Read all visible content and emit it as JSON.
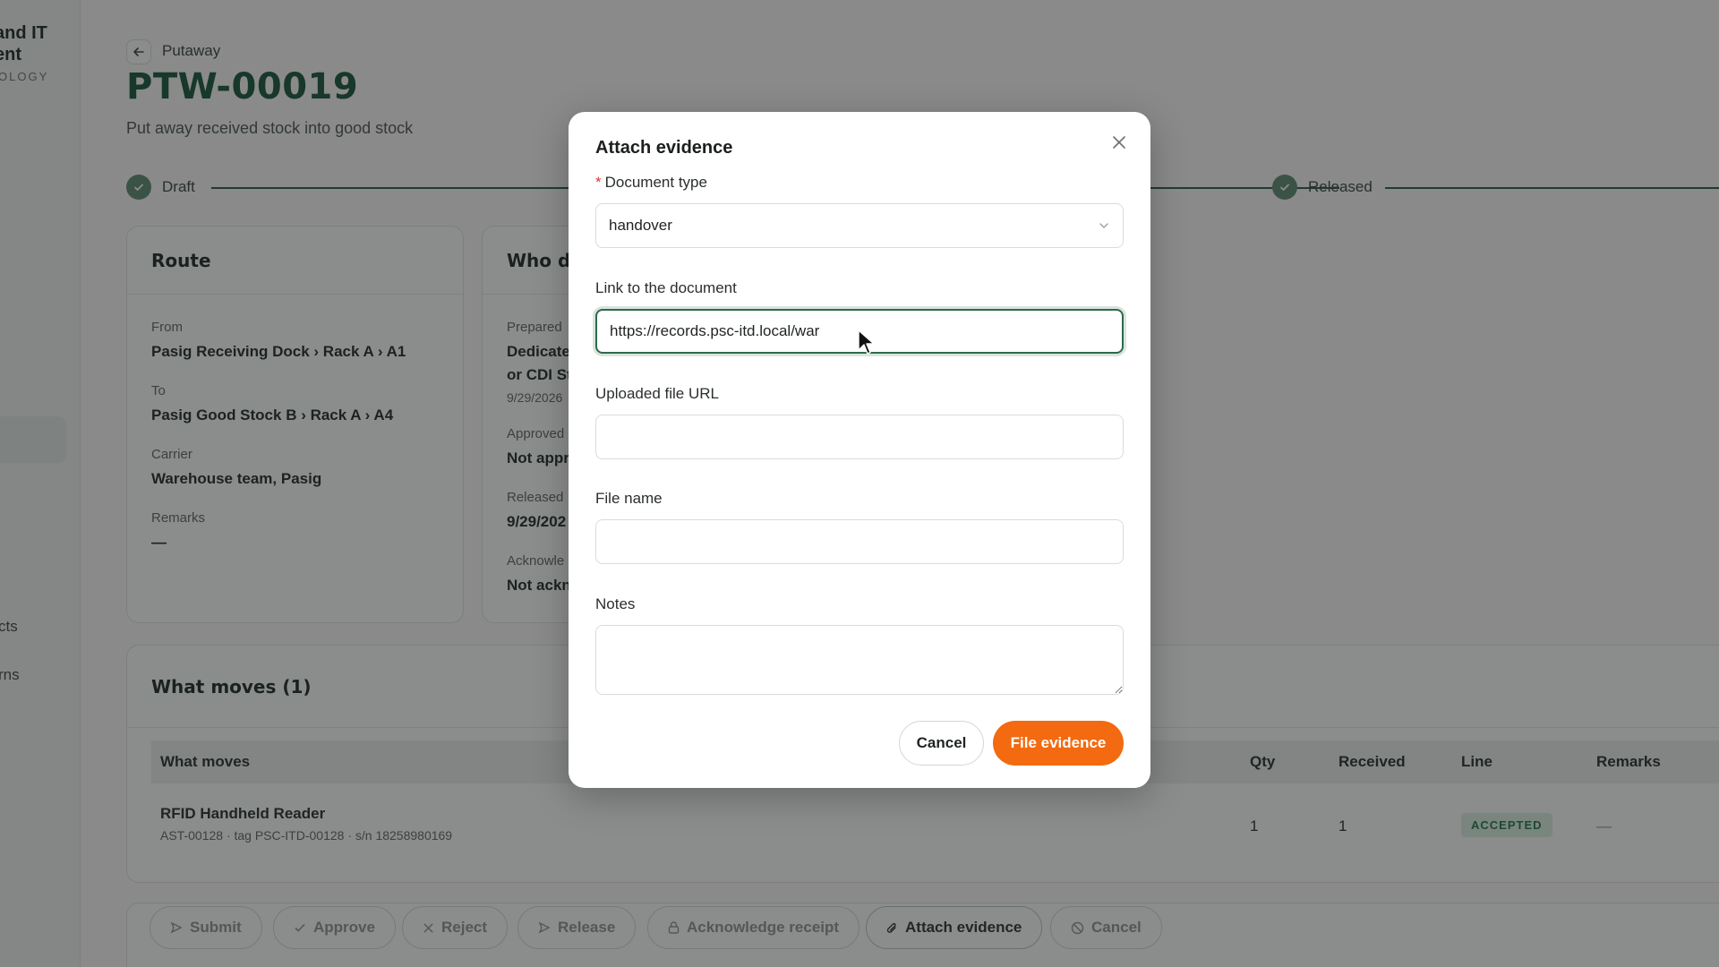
{
  "sidebar": {
    "brand_line1": "and IT",
    "brand_line2": "ent",
    "brand_sub": "OLOGY",
    "items": [
      {
        "label": "cts"
      },
      {
        "label": "rns"
      }
    ]
  },
  "header": {
    "breadcrumb": "Putaway",
    "title": "PTW-00019",
    "subtitle": "Put away received stock into good stock"
  },
  "stepper": {
    "steps": [
      {
        "label": "Draft"
      },
      {
        "label": "Released"
      }
    ]
  },
  "route_card": {
    "title": "Route",
    "from_label": "From",
    "from_value": "Pasig Receiving Dock › Rack A › A1",
    "to_label": "To",
    "to_value": "Pasig Good Stock B › Rack A › A4",
    "carrier_label": "Carrier",
    "carrier_value": "Warehouse team, Pasig",
    "remarks_label": "Remarks",
    "remarks_value": "—"
  },
  "who_card": {
    "title": "Who d",
    "prepared_label": "Prepared",
    "prepared_value_1": "Dedicate",
    "prepared_value_2": "or CDI St",
    "prepared_date": "9/29/2026",
    "approved_label": "Approved",
    "approved_value": "Not appr",
    "released_label": "Released",
    "released_value": "9/29/202",
    "acknowledged_label": "Acknowle",
    "acknowledged_value": "Not ackn"
  },
  "moves": {
    "title": "What moves (1)",
    "columns": [
      "What moves",
      "Qty",
      "Received",
      "Line",
      "Remarks"
    ],
    "rows": [
      {
        "name": "RFID Handheld Reader",
        "meta": "AST-00128 · tag PSC-ITD-00128 · s/n 18258980169",
        "qty": "1",
        "received": "1",
        "line": "ACCEPTED",
        "remarks": "—"
      }
    ]
  },
  "actions": {
    "submit": "Submit",
    "approve": "Approve",
    "reject": "Reject",
    "release": "Release",
    "acknowledge": "Acknowledge receipt",
    "attach": "Attach evidence",
    "cancel": "Cancel"
  },
  "modal": {
    "title": "Attach evidence",
    "document_type_label": "Document type",
    "document_type_value": "handover",
    "link_label": "Link to the document",
    "link_value": "https://records.psc-itd.local/war",
    "uploaded_label": "Uploaded file URL",
    "uploaded_value": "",
    "file_name_label": "File name",
    "file_name_value": "",
    "notes_label": "Notes",
    "notes_value": "",
    "cancel_label": "Cancel",
    "submit_label": "File evidence"
  },
  "colors": {
    "primary_green": "#17563a",
    "accent_orange": "#f36a10",
    "accepted_badge": "#1e7a47"
  }
}
